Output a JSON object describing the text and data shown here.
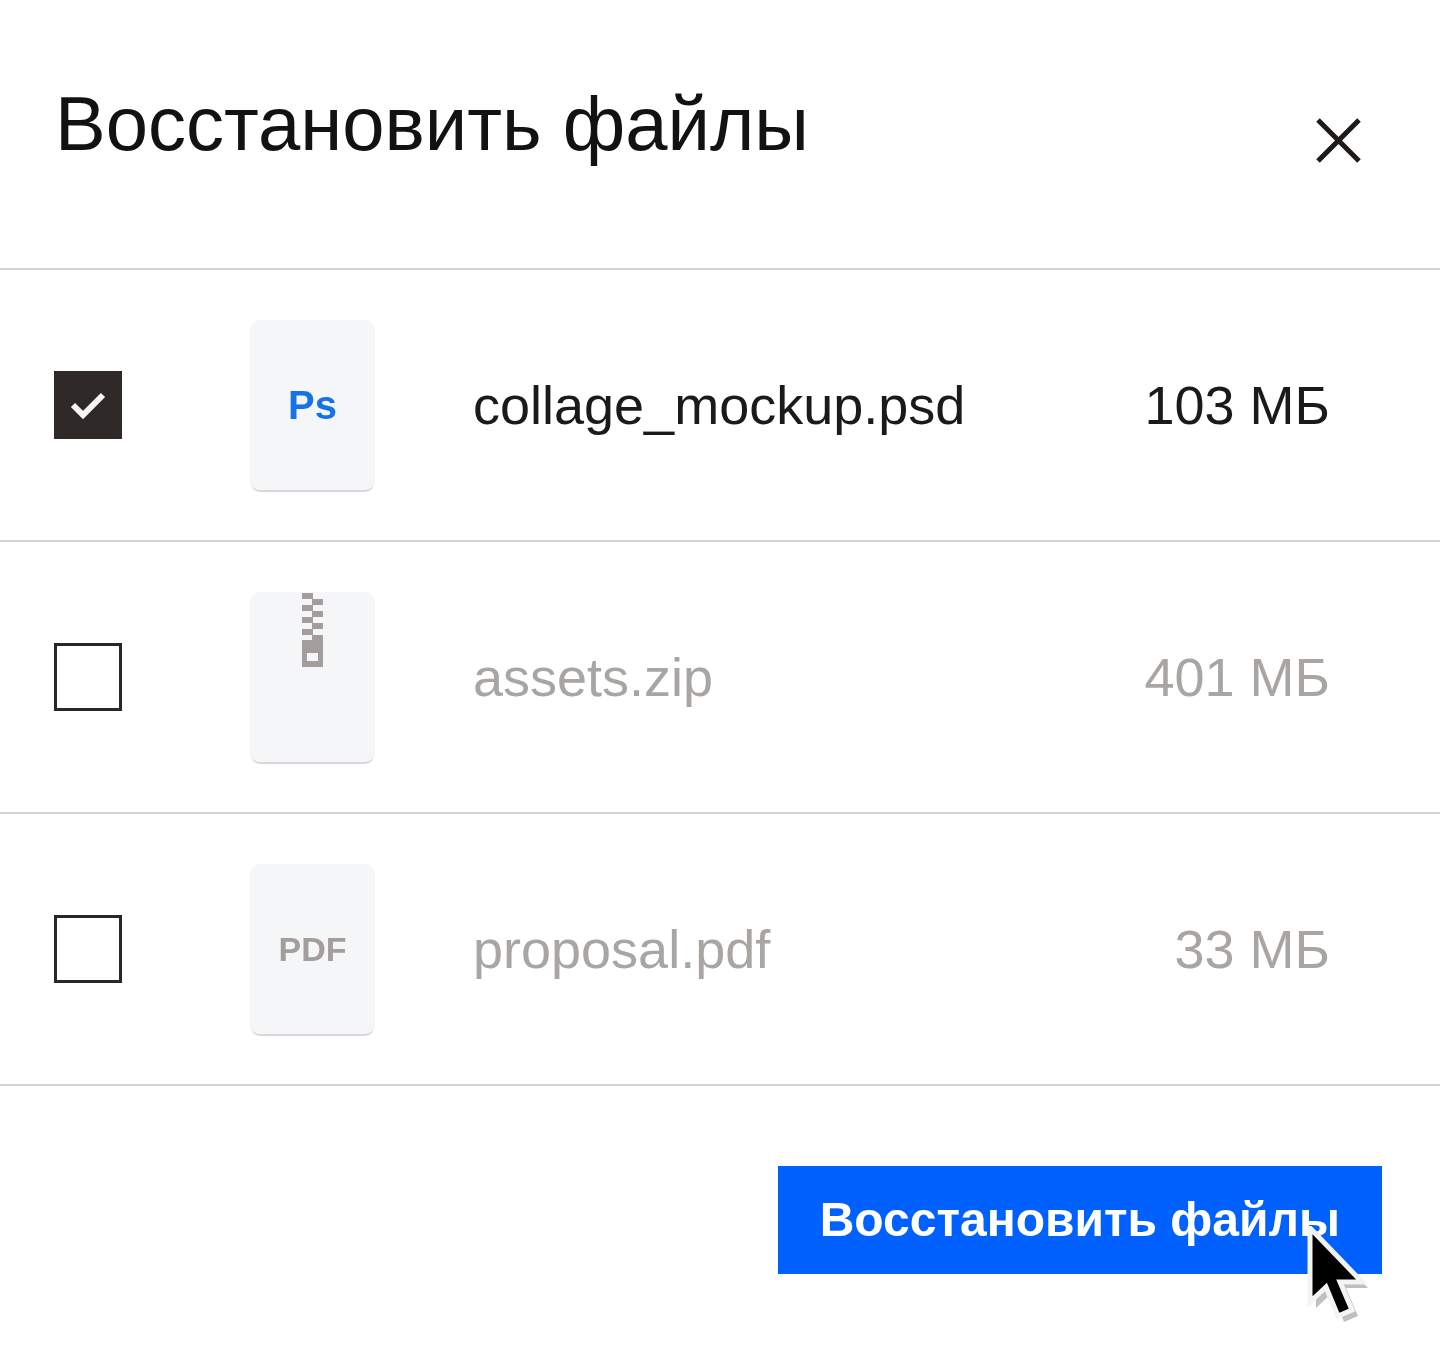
{
  "dialog": {
    "title": "Восстановить файлы"
  },
  "files": [
    {
      "kind": "psd",
      "badge": "Ps",
      "name": "collage_mockup.psd",
      "size": "103 МБ",
      "checked": true
    },
    {
      "kind": "zip",
      "name": "assets.zip",
      "size": "401 МБ",
      "checked": false
    },
    {
      "kind": "pdf",
      "badge": "PDF",
      "name": "proposal.pdf",
      "size": "33 МБ",
      "checked": false
    }
  ],
  "restore_button": {
    "label": "Восстановить файлы"
  }
}
